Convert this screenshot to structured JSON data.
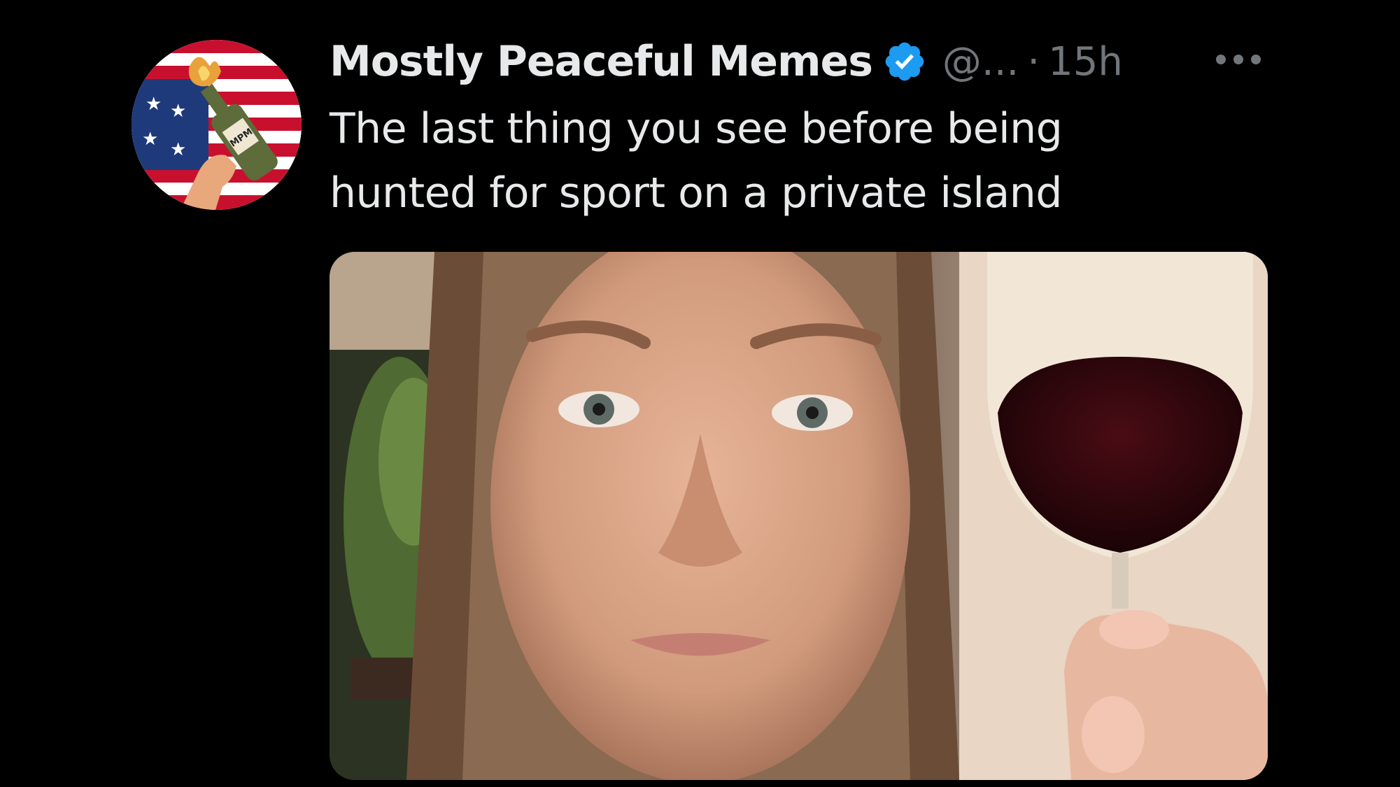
{
  "tweet": {
    "display_name": "Mostly Peaceful Memes",
    "handle": "@...",
    "separator": "·",
    "timestamp": "15h",
    "text": "The last thing you see before being hunted for sport on a private island",
    "verified": true
  },
  "avatar": {
    "badge_text": "MPM",
    "icon": "flag-bottle-avatar"
  },
  "media": {
    "icon": "selfie-with-wine-glass-photo"
  },
  "icons": {
    "verified": "verified-badge-icon",
    "more": "more-options-icon"
  },
  "colors": {
    "background": "#000000",
    "text_primary": "#e7e9ea",
    "text_secondary": "#71767b",
    "verified_blue": "#1d9bf0"
  }
}
